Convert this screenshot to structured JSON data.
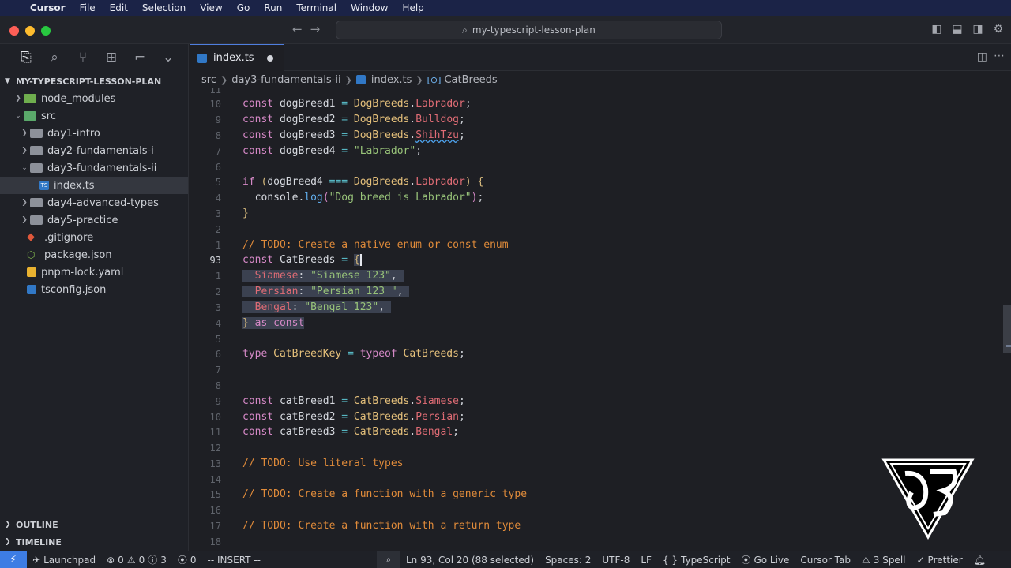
{
  "menubar": {
    "items": [
      "Cursor",
      "File",
      "Edit",
      "Selection",
      "View",
      "Go",
      "Run",
      "Terminal",
      "Window",
      "Help"
    ]
  },
  "title": {
    "search": "my-typescript-lesson-plan"
  },
  "sidebar": {
    "root": "MY-TYPESCRIPT-LESSON-PLAN",
    "items": [
      {
        "label": "node_modules"
      },
      {
        "label": "src"
      },
      {
        "label": "day1-intro"
      },
      {
        "label": "day2-fundamentals-i"
      },
      {
        "label": "day3-fundamentals-ii"
      },
      {
        "label": "index.ts"
      },
      {
        "label": "day4-advanced-types"
      },
      {
        "label": "day5-practice"
      },
      {
        "label": ".gitignore"
      },
      {
        "label": "package.json"
      },
      {
        "label": "pnpm-lock.yaml"
      },
      {
        "label": "tsconfig.json"
      }
    ],
    "outline": "OUTLINE",
    "timeline": "TIMELINE"
  },
  "tab": {
    "label": "index.ts"
  },
  "breadcrumb": {
    "src": "src",
    "folder": "day3-fundamentals-ii",
    "file": "index.ts",
    "symbol": "CatBreeds"
  },
  "lines": [
    "11",
    "10",
    "9",
    "8",
    "7",
    "6",
    "5",
    "4",
    "3",
    "2",
    "1",
    "93",
    "1",
    "2",
    "3",
    "4",
    "5",
    "6",
    "7",
    "8",
    "9",
    "10",
    "11",
    "12",
    "13",
    "14",
    "15",
    "16",
    "17",
    "18"
  ],
  "status": {
    "launchpad": "Launchpad",
    "errors": "0",
    "warnings": "0",
    "info": "3",
    "ports": "0",
    "mode": "-- INSERT --",
    "position": "Ln 93, Col 20 (88 selected)",
    "spaces": "Spaces: 2",
    "encoding": "UTF-8",
    "eol": "LF",
    "language": "TypeScript",
    "golive": "Go Live",
    "cursortab": "Cursor Tab",
    "spell": "3 Spell",
    "prettier": "Prettier"
  }
}
